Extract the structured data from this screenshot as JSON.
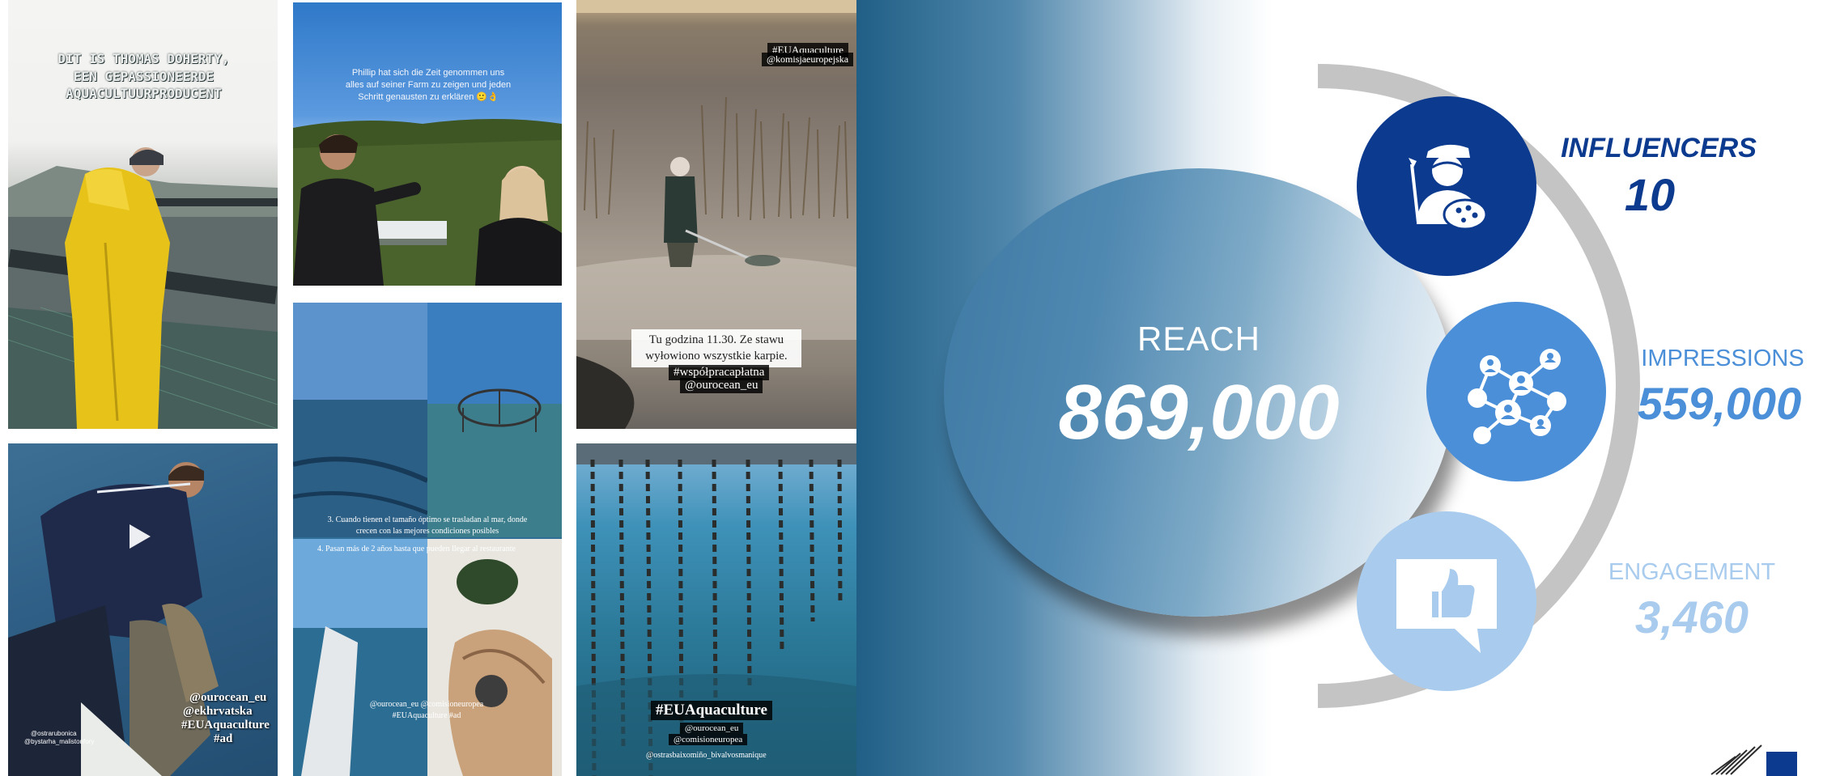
{
  "posts": [
    {
      "caption": "DIT IS THOMAS DOHERTY, EEN GEPASSIONEERDE AQUACULTUURPRODUCENT"
    },
    {
      "caption": "Phillip hat sich die Zeit genommen uns alles auf seiner Farm zu zeigen und jeden Schritt genausten zu erklären 🙂👌"
    },
    {
      "tag_top": "#EUAquaculture",
      "tag_top2": "@komisjaeuropejska",
      "caption": "Tu godzina 11.30. Ze stawu wyłowiono wszystkie karpie.",
      "tag1": "#współpracapłatna",
      "tag2": "@ourocean_eu"
    },
    {
      "tags": [
        "@ourocean_eu",
        "@ekhrvatska",
        "#EUAquaculture",
        "#ad"
      ],
      "small": [
        "@ostrarubonica",
        "@bystarha_malistonfory"
      ]
    },
    {
      "caption1": "3. Cuando tienen el tamaño óptimo se trasladan al mar, donde crecen con las mejores condiciones posibles",
      "caption2": "4. Pasan más de 2 años hasta que pueden llegar al restaurante",
      "tags": "@ourocean_eu @comisioneuropea #EUAquaculture #ad"
    },
    {
      "tag_main": "#EUAquaculture",
      "tags": [
        "@ourocean_eu",
        "@comisioneuropea",
        "@ostrasbaixomiño_bivalvosmanique"
      ]
    }
  ],
  "stats": {
    "reach": {
      "label": "REACH",
      "value": "869,000"
    },
    "influencers": {
      "label": "INFLUENCERS",
      "value": "10"
    },
    "impressions": {
      "label": "IMPRESSIONS",
      "value": "559,000"
    },
    "engagement": {
      "label": "ENGAGEMENT",
      "value": "3,460"
    }
  },
  "colors": {
    "dark_blue": "#0b3a8f",
    "mid_blue": "#4a8fd8",
    "light_blue": "#a8cbee",
    "reach_fill": "#4f88b1",
    "arc_gray": "#c4c4c4"
  }
}
